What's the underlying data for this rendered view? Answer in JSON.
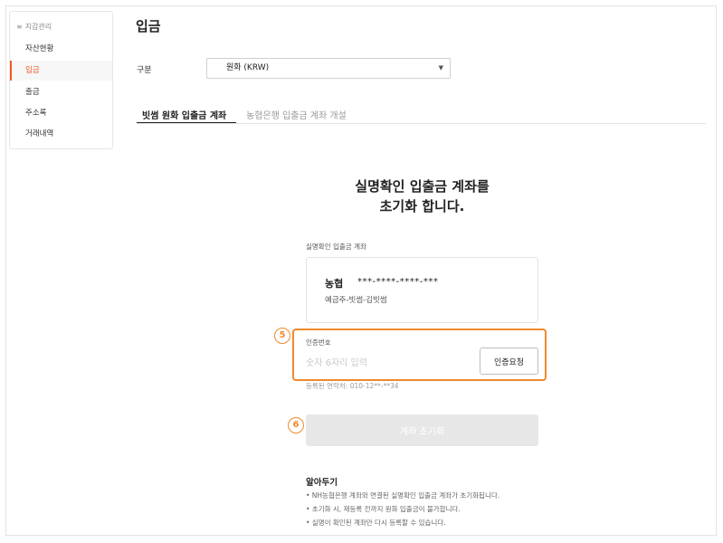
{
  "sidebar": {
    "header": "지갑관리",
    "items": [
      {
        "label": "자산현황",
        "active": false
      },
      {
        "label": "입금",
        "active": true
      },
      {
        "label": "출금",
        "active": false
      },
      {
        "label": "주소록",
        "active": false
      },
      {
        "label": "거래내역",
        "active": false
      }
    ]
  },
  "page": {
    "title": "입금"
  },
  "currency": {
    "label": "구분",
    "selected": "원화 (KRW)"
  },
  "tabs": [
    {
      "label": "빗썸 원화 입출금 계좌",
      "active": true
    },
    {
      "label": "농협은행 입출금 계좌 개설",
      "active": false
    }
  ],
  "main": {
    "headline_line1": "실명확인 입출금 계좌를",
    "headline_line2": "초기화 합니다.",
    "account_section_label": "실명확인 입출금 계좌",
    "account": {
      "bank": "농협",
      "number": "***-****-****-***",
      "holder": "예금주-빗썸-김빗썸"
    },
    "auth": {
      "label": "인증번호",
      "placeholder": "숫자 6자리 입력",
      "value": "",
      "button": "인증요청",
      "contact": "등록된 연락처: 010-12**-**34"
    },
    "reset_button": "계좌 초기화",
    "steps": [
      "5",
      "6"
    ],
    "notice": {
      "title": "알아두기",
      "items": [
        "• NH농협은행 계좌와 연결된 실명확인 입출금 계좌가 초기화됩니다.",
        "• 초기화 시, 재등록 전까지 원화 입출금이 불가합니다.",
        "• 실명이 확인된 계좌만 다시 등록할 수 있습니다."
      ]
    }
  },
  "colors": {
    "accent": "#f05a23",
    "highlight": "#f08a2c",
    "disabled_button": "#e7e7e7"
  }
}
